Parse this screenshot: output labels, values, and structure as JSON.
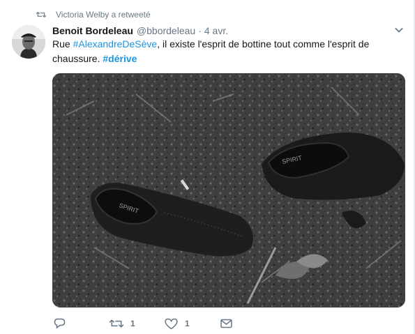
{
  "retweet_context": {
    "text": "Victoria Welby a retweeté",
    "icon": "retweet-icon"
  },
  "tweet": {
    "author_name": "Benoit Bordeleau",
    "handle": "@bbordeleau",
    "separator": "·",
    "time": "4 avr.",
    "text_parts": {
      "p1": "Rue ",
      "tag1": "#AlexandreDeSève",
      "p2": ", il existe l'esprit de bottine tout comme l'esprit de chaussure. ",
      "tag2": "#dérive"
    },
    "media": {
      "description_icon": "photo-shoes",
      "shoe_brand_left": "SPIRIT",
      "shoe_brand_right": "SPIRIT"
    }
  },
  "actions": {
    "reply": {
      "icon": "reply-icon",
      "count": ""
    },
    "retweet": {
      "icon": "retweet-icon",
      "count": "1"
    },
    "like": {
      "icon": "heart-icon",
      "count": "1"
    },
    "dm": {
      "icon": "envelope-icon",
      "count": ""
    }
  },
  "colors": {
    "link": "#1b95e0",
    "muted": "#657786",
    "text": "#14171a"
  }
}
